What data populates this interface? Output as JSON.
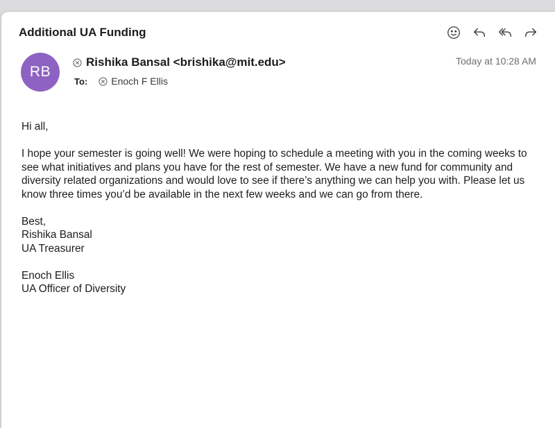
{
  "email": {
    "subject": "Additional UA Funding",
    "avatar_initials": "RB",
    "avatar_color": "#8e62c2",
    "sender": "Rishika Bansal <brishika@mit.edu>",
    "to_label": "To:",
    "recipient": "Enoch F Ellis",
    "date": "Today at 10:28 AM"
  },
  "toolbar": {
    "icons": [
      "smiley-icon",
      "reply-icon",
      "reply-all-icon",
      "forward-icon"
    ]
  },
  "body": {
    "greeting": "Hi all,",
    "paragraph": "I hope your semester is going well! We were hoping to schedule a meeting with you in the coming weeks to see what initiatives and plans you have for the rest of semester. We have a new fund for community and diversity related organizations and would love to see if there’s anything we can help you with. Please let us know three times you’d be available in the next few weeks and we can go from there.",
    "closing": "Best,",
    "sig1_name": "Rishika Bansal",
    "sig1_title": "UA Treasurer",
    "sig2_name": "Enoch Ellis",
    "sig2_title": "UA Officer of Diversity"
  }
}
